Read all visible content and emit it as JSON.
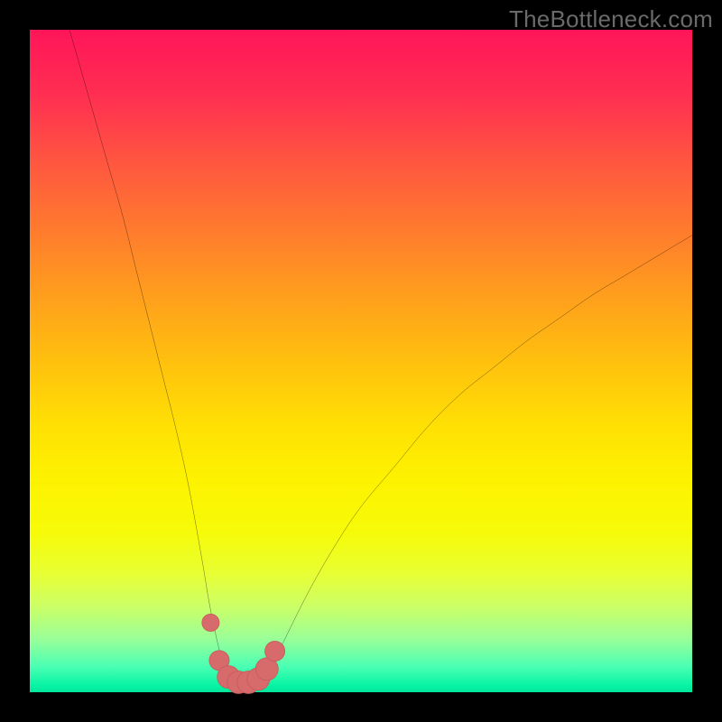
{
  "watermark": "TheBottleneck.com",
  "colors": {
    "background": "#000000",
    "curve_stroke": "#000000",
    "marker_fill": "#d76b6b",
    "marker_stroke": "#c85a5a"
  },
  "chart_data": {
    "type": "line",
    "title": "",
    "xlabel": "",
    "ylabel": "",
    "xlim": [
      0,
      100
    ],
    "ylim": [
      0,
      100
    ],
    "series": [
      {
        "name": "bottleneck-curve",
        "x": [
          6,
          8,
          10,
          12,
          14,
          16,
          18,
          20,
          22,
          24,
          26,
          27,
          28,
          29,
          30,
          31,
          32,
          33,
          34,
          36,
          38,
          42,
          46,
          50,
          55,
          60,
          65,
          70,
          75,
          80,
          85,
          90,
          95,
          100
        ],
        "values": [
          100,
          93,
          86,
          79,
          72,
          64,
          56,
          48,
          40,
          31,
          20,
          14,
          9,
          5,
          2.5,
          1.5,
          1.2,
          1.2,
          1.5,
          3,
          7,
          15,
          22,
          28,
          34,
          40,
          45,
          49,
          53,
          56.5,
          60,
          63,
          66,
          69
        ]
      }
    ],
    "markers": [
      {
        "x": 27.3,
        "y": 10.5,
        "r": 1.3
      },
      {
        "x": 28.6,
        "y": 4.8,
        "r": 1.5
      },
      {
        "x": 30.0,
        "y": 2.3,
        "r": 1.7
      },
      {
        "x": 31.5,
        "y": 1.5,
        "r": 1.7
      },
      {
        "x": 33.0,
        "y": 1.5,
        "r": 1.7
      },
      {
        "x": 34.5,
        "y": 2.0,
        "r": 1.7
      },
      {
        "x": 35.8,
        "y": 3.5,
        "r": 1.7
      },
      {
        "x": 37.0,
        "y": 6.2,
        "r": 1.5
      }
    ],
    "gradient_stops": [
      {
        "pct": 0,
        "color": "#ff1559"
      },
      {
        "pct": 50,
        "color": "#ffc00e"
      },
      {
        "pct": 76,
        "color": "#f6fb09"
      },
      {
        "pct": 100,
        "color": "#00e69c"
      }
    ]
  }
}
